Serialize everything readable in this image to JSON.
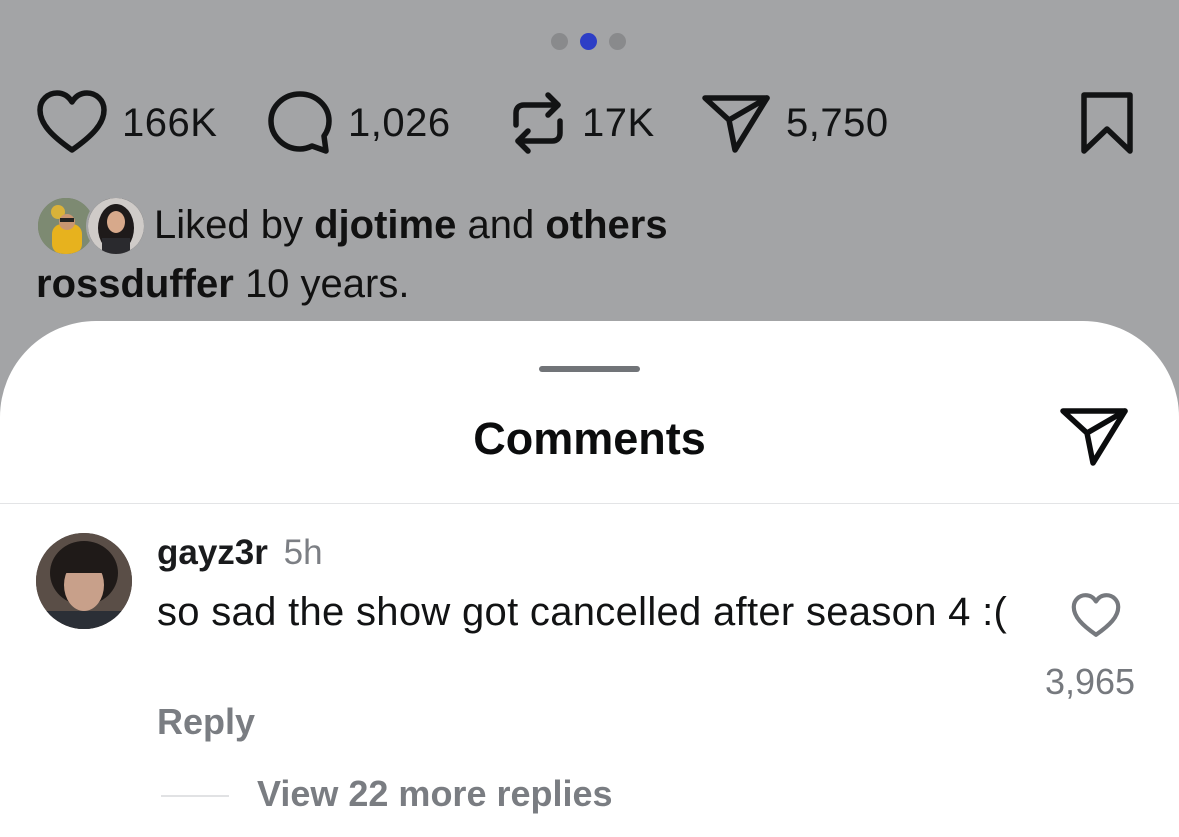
{
  "carousel": {
    "total_dots": 3,
    "active_index": 1
  },
  "actions": {
    "likes": "166K",
    "comments": "1,026",
    "reposts": "17K",
    "shares": "5,750"
  },
  "liked_by": {
    "prefix": "Liked by",
    "user": "djotime",
    "middle": "and",
    "suffix": "others"
  },
  "caption": {
    "user": "rossduffer",
    "text": "10 years."
  },
  "sheet": {
    "title": "Comments"
  },
  "comment": {
    "user": "gayz3r",
    "time": "5h",
    "text": "so sad the show got cancelled after season 4 :(",
    "likes": "3,965",
    "reply_label": "Reply",
    "more_replies": "View 22 more replies"
  },
  "colors": {
    "background_dim": "#a3a4a6",
    "active_dot": "#2d3ec6",
    "secondary_text": "#7a7d82"
  },
  "icons": [
    "heart-icon",
    "comment-bubble-icon",
    "repost-icon",
    "send-icon",
    "bookmark-icon"
  ]
}
